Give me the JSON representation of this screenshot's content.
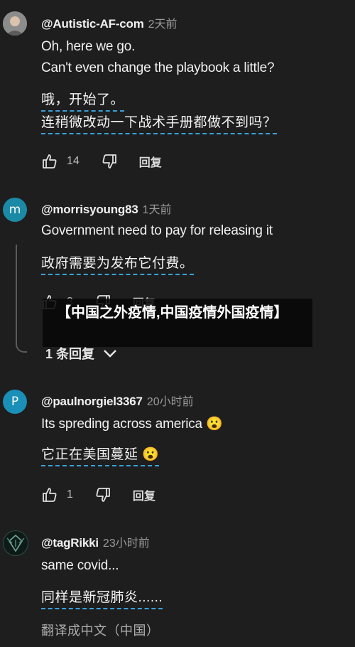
{
  "comments": [
    {
      "handle": "@Autistic-AF-com",
      "time": "2天前",
      "lines": [
        "Oh, here we go.",
        "Can't even change the playbook a little?"
      ],
      "translation": [
        "哦，开始了。",
        "连稍微改动一下战术手册都做不到吗？"
      ],
      "likes": "14",
      "reply_label": "回复"
    },
    {
      "avatar_letter": "m",
      "handle": "@morrisyoung83",
      "time": "1天前",
      "lines": [
        "Government need to pay for releasing it"
      ],
      "translation": [
        "政府需要为发布它付费。"
      ],
      "likes": "3",
      "reply_label": "回复",
      "replies_toggle": "1 条回复"
    },
    {
      "avatar_letter": "P",
      "handle": "@paulnorgiel3367",
      "time": "20小时前",
      "lines": [
        "Its spreding across america 😮"
      ],
      "translation": [
        "它正在美国蔓延 😮"
      ],
      "likes": "1",
      "reply_label": "回复"
    },
    {
      "handle": "@tagRikki",
      "time": "23小时前",
      "lines": [
        "same covid..."
      ],
      "translation": [
        "同样是新冠肺炎......"
      ],
      "translate_link": "翻译成中文（中国）"
    }
  ],
  "overlay_title": "【中国之外疫情,中国疫情外国疫情】",
  "icons": [
    "thumbs-up-icon",
    "thumbs-down-icon",
    "chevron-down-icon"
  ],
  "colors": {
    "background": "#1e1e1e",
    "dashed_underline": "#3aa0d8",
    "avatar_blue": "#1b8aa6"
  }
}
